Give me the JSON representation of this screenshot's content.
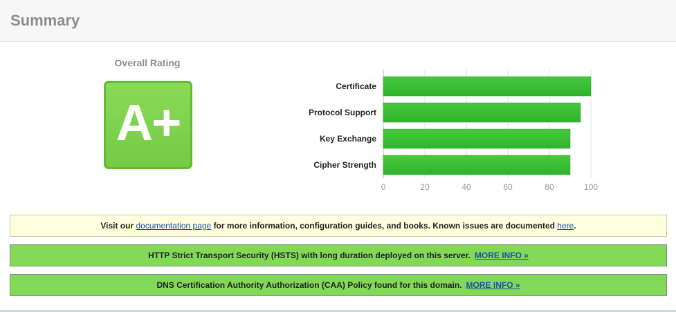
{
  "header": {
    "title": "Summary"
  },
  "rating": {
    "label": "Overall Rating",
    "grade": "A+"
  },
  "chart_data": {
    "type": "bar",
    "orientation": "horizontal",
    "categories": [
      "Certificate",
      "Protocol Support",
      "Key Exchange",
      "Cipher Strength"
    ],
    "values": [
      100,
      95,
      90,
      90
    ],
    "xlim": [
      0,
      100
    ],
    "xticks": [
      0,
      20,
      40,
      60,
      80,
      100
    ],
    "grid": true,
    "bar_color": "#2fb32a",
    "title": "",
    "xlabel": "",
    "ylabel": ""
  },
  "notices": {
    "docs": {
      "prefix": "Visit our ",
      "link1": "documentation page",
      "middle": " for more information, configuration guides, and books. Known issues are documented ",
      "link2": "here",
      "suffix": "."
    },
    "hsts": {
      "text": "HTTP Strict Transport Security (HSTS) with long duration deployed on this server.",
      "more": "MORE INFO »"
    },
    "caa": {
      "text": "DNS Certification Authority Authorization (CAA) Policy found for this domain.",
      "more": "MORE INFO »"
    }
  },
  "colors": {
    "grade_green": "#7ed24d",
    "notice_green": "#82d957",
    "notice_yellow": "#ffffdd",
    "link_blue": "#1c4fb0"
  }
}
